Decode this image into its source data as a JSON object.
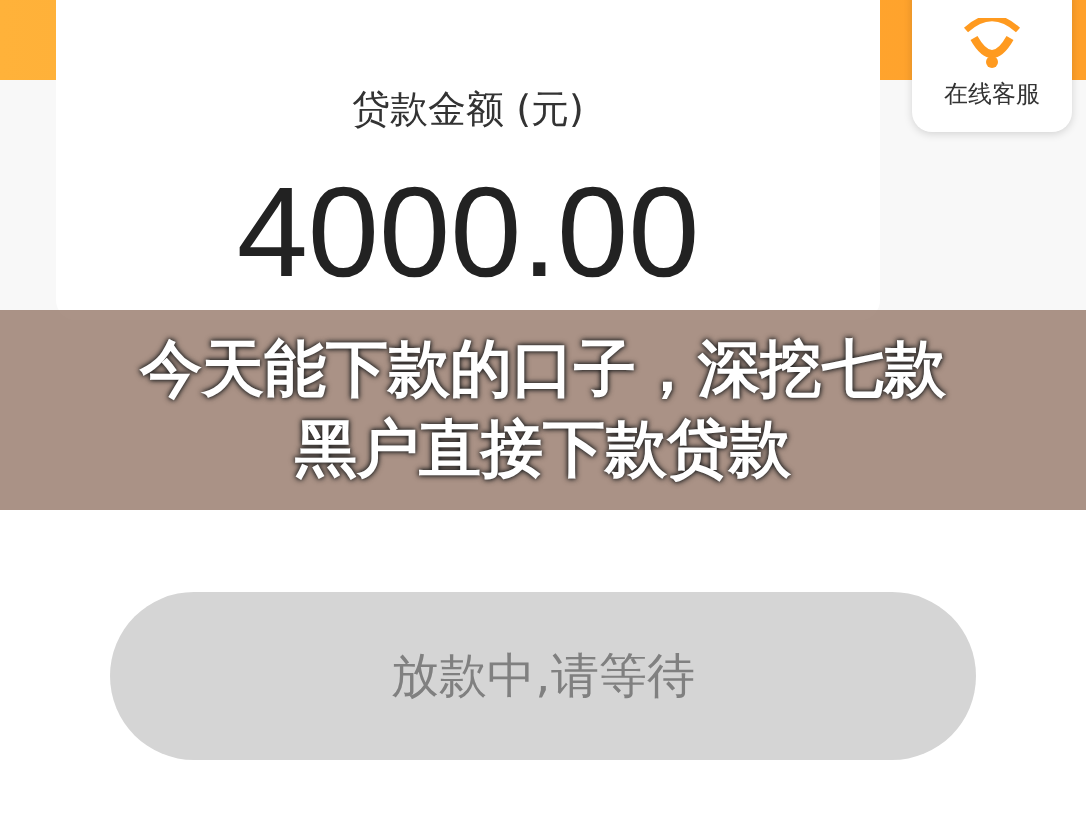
{
  "amount_card": {
    "label": "贷款金额 (元)",
    "amount": "4000.00"
  },
  "service_button": {
    "label": "在线客服"
  },
  "banner": {
    "lines": [
      "今天能下款的口子，深挖七款",
      "黑户直接下款贷款"
    ]
  },
  "status_button": {
    "label": "放款中,请等待",
    "disabled": true
  }
}
